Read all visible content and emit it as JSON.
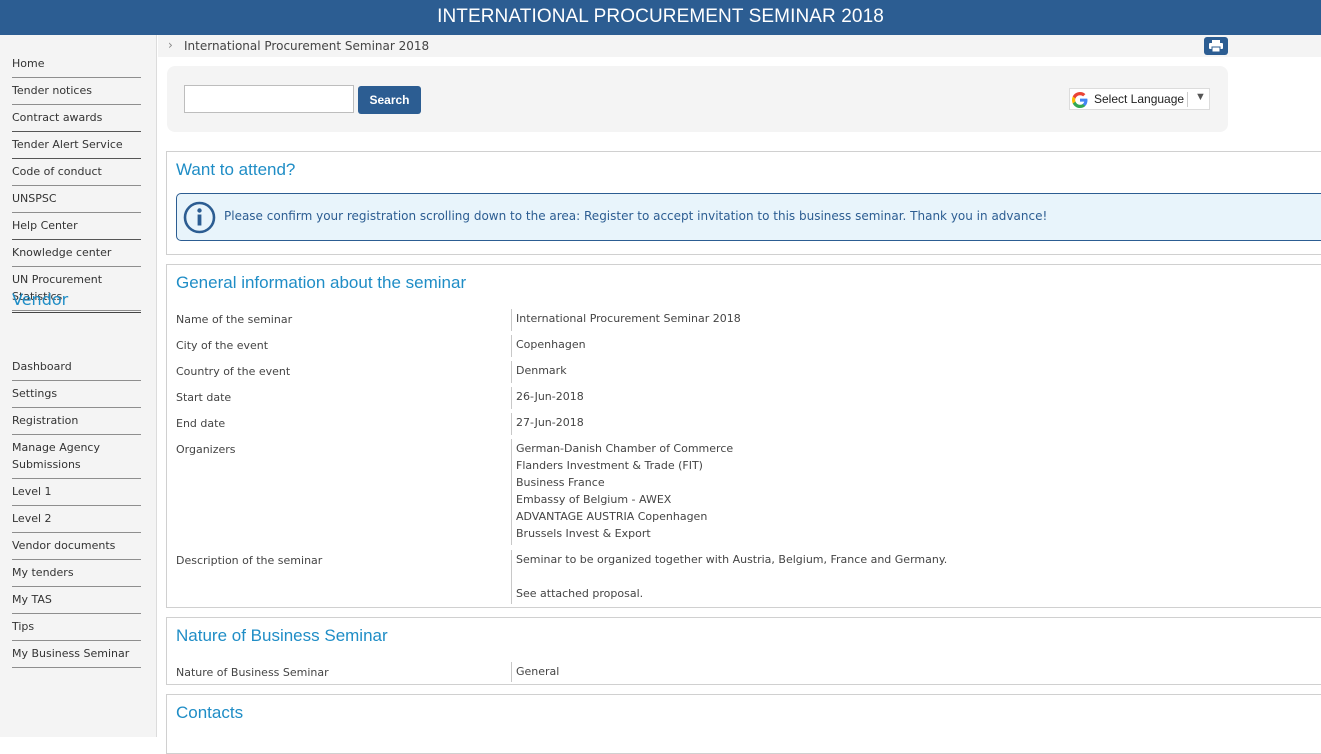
{
  "header": {
    "title": "INTERNATIONAL PROCUREMENT SEMINAR 2018"
  },
  "sidebar": {
    "items": [
      "Home",
      "Tender notices",
      "Contract awards",
      "Tender Alert Service",
      "Code of conduct",
      "UNSPSC",
      "Help Center",
      "Knowledge center",
      "UN Procurement Statistics"
    ],
    "vendor_heading": "Vendor",
    "vendor_items": [
      "Dashboard",
      "Settings",
      "Registration",
      "Manage Agency Submissions",
      "Level 1",
      "Level 2",
      "Vendor documents",
      "My tenders",
      "My TAS",
      "Tips",
      "My Business Seminar"
    ]
  },
  "breadcrumb": {
    "current": "International Procurement Seminar 2018"
  },
  "search": {
    "value": "",
    "button_label": "Search"
  },
  "language": {
    "label": "Select Language"
  },
  "attend": {
    "title": "Want to attend?",
    "notice": "Please confirm your registration scrolling down to the area: Register to accept invitation to this business seminar. Thank you in advance!"
  },
  "general": {
    "title": "General information about the seminar",
    "rows": [
      {
        "label": "Name of the seminar",
        "value": "International Procurement Seminar 2018"
      },
      {
        "label": "City of the event",
        "value": "Copenhagen"
      },
      {
        "label": "Country of the event",
        "value": "Denmark"
      },
      {
        "label": "Start date",
        "value": "26-Jun-2018"
      },
      {
        "label": "End date",
        "value": "27-Jun-2018"
      }
    ],
    "organizers_label": "Organizers",
    "organizers": [
      "German-Danish Chamber of Commerce",
      "Flanders Investment & Trade (FIT)",
      "Business France",
      "Embassy of Belgium - AWEX",
      "ADVANTAGE AUSTRIA Copenhagen",
      "Brussels Invest & Export"
    ],
    "description_label": "Description of the seminar",
    "description_line1": "Seminar to be organized together with Austria, Belgium, France and Germany.",
    "description_line2": "See attached proposal."
  },
  "nature": {
    "title": "Nature of Business Seminar",
    "label": "Nature of Business Seminar",
    "value": "General"
  },
  "contacts": {
    "title": "Contacts"
  },
  "colors": {
    "header_bg": "#2c5d92",
    "accent": "#1f8dc6"
  }
}
